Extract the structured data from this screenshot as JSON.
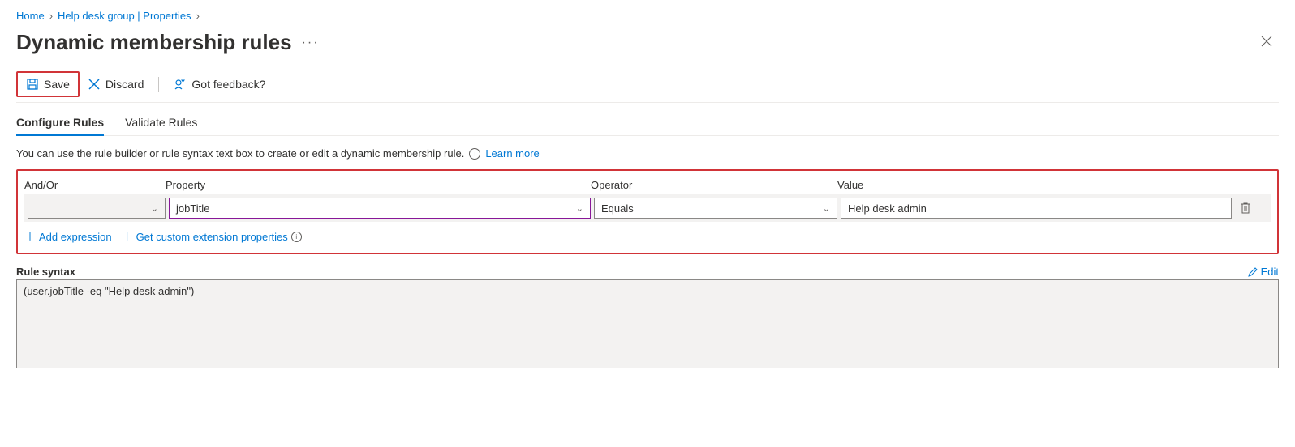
{
  "breadcrumb": {
    "home": "Home",
    "group": "Help desk group | Properties"
  },
  "page_title": "Dynamic membership rules",
  "toolbar": {
    "save": "Save",
    "discard": "Discard",
    "feedback": "Got feedback?"
  },
  "tabs": {
    "configure": "Configure Rules",
    "validate": "Validate Rules"
  },
  "helptext": {
    "text": "You can use the rule builder or rule syntax text box to create or edit a dynamic membership rule.",
    "learn_more": "Learn more"
  },
  "columns": {
    "andor": "And/Or",
    "property": "Property",
    "operator": "Operator",
    "value": "Value"
  },
  "row": {
    "andor": "",
    "property": "jobTitle",
    "operator": "Equals",
    "value": "Help desk admin"
  },
  "actions": {
    "add_expression": "Add expression",
    "get_ext": "Get custom extension properties"
  },
  "syntax": {
    "label": "Rule syntax",
    "edit": "Edit",
    "text": "(user.jobTitle -eq \"Help desk admin\")"
  }
}
